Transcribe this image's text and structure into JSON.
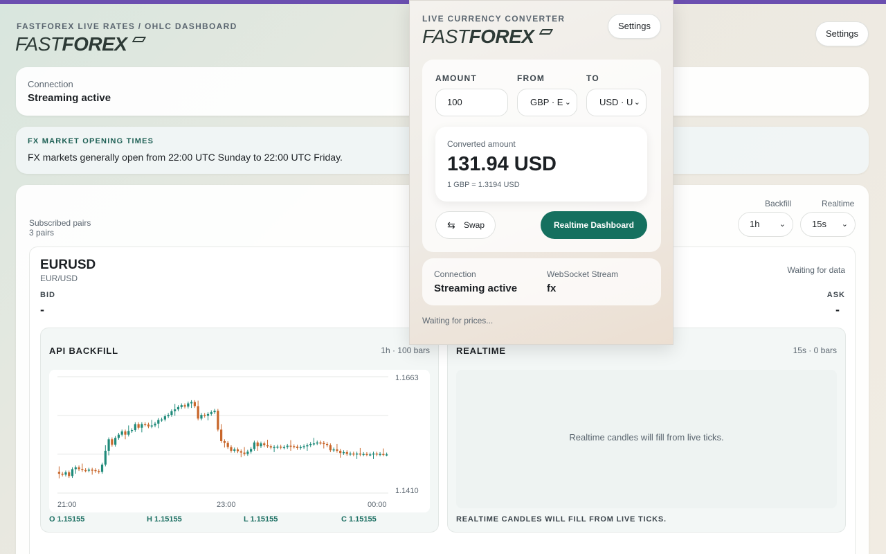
{
  "dashboard": {
    "subtitle": "FASTFOREX LIVE RATES / OHLC DASHBOARD",
    "logo_thin": "FAST",
    "logo_bold": "FOREX",
    "settings_label": "Settings",
    "connection": {
      "label": "Connection",
      "value": "Streaming active"
    },
    "market_info": {
      "title": "FX MARKET OPENING TIMES",
      "text": "FX markets generally open from 22:00 UTC Sunday to 22:00 UTC Friday."
    },
    "subscriptions": {
      "label": "Subscribed pairs",
      "count": "3 pairs"
    },
    "controls": {
      "backfill": {
        "label": "Backfill",
        "value": "1h"
      },
      "realtime": {
        "label": "Realtime",
        "value": "15s"
      }
    },
    "pair": {
      "symbol": "EURUSD",
      "name": "EUR/USD",
      "status": "Waiting for data",
      "bid_label": "BID",
      "bid_value": "-",
      "ask_label": "ASK",
      "ask_value": "-",
      "backfill_panel": {
        "title": "API BACKFILL",
        "meta": "1h · 100 bars",
        "ohlc": [
          "O 1.15155",
          "H 1.15155",
          "L 1.15155",
          "C 1.15155"
        ]
      },
      "realtime_panel": {
        "title": "REALTIME",
        "meta": "15s · 0 bars",
        "message": "Realtime candles will fill from live ticks.",
        "footer": "REALTIME CANDLES WILL FILL FROM LIVE TICKS."
      }
    }
  },
  "chart_data": {
    "type": "candlestick",
    "title": "",
    "x_tick_labels": [
      "21:00",
      "23:00",
      "00:00"
    ],
    "y_tick_labels": [
      "1.1663",
      "1.1410"
    ],
    "ylim": [
      1.141,
      1.1663
    ],
    "colors": {
      "up": "#1f8a7a",
      "down": "#c8662a"
    },
    "closes": [
      1.1452,
      1.145,
      1.1455,
      1.1447,
      1.1462,
      1.1466,
      1.1462,
      1.146,
      1.1459,
      1.1461,
      1.146,
      1.1458,
      1.1456,
      1.1472,
      1.1502,
      1.1527,
      1.1515,
      1.153,
      1.1537,
      1.1544,
      1.1537,
      1.1545,
      1.1547,
      1.156,
      1.1552,
      1.156,
      1.1559,
      1.1555,
      1.1557,
      1.1561,
      1.1569,
      1.157,
      1.1577,
      1.158,
      1.1588,
      1.1592,
      1.1597,
      1.1601,
      1.1598,
      1.1605,
      1.1608,
      1.1599,
      1.1572,
      1.158,
      1.1578,
      1.1582,
      1.1586,
      1.1589,
      1.1548,
      1.1523,
      1.1519,
      1.151,
      1.1502,
      1.1505,
      1.1501,
      1.1498,
      1.1495,
      1.15,
      1.1506,
      1.152,
      1.1512,
      1.1518,
      1.1514,
      1.1512,
      1.1509,
      1.151,
      1.1511,
      1.1509,
      1.151,
      1.1513,
      1.1512,
      1.1511,
      1.1508,
      1.151,
      1.1512,
      1.1514,
      1.1517,
      1.1518,
      1.152,
      1.1519,
      1.1517,
      1.1514,
      1.1503,
      1.1505,
      1.1502,
      1.1497,
      1.1499,
      1.1495,
      1.1496,
      1.1494,
      1.1496,
      1.1494,
      1.1495,
      1.1494,
      1.1494,
      1.1496,
      1.1494,
      1.1495,
      1.1494,
      1.1494
    ]
  },
  "converter": {
    "subtitle": "LIVE CURRENCY CONVERTER",
    "settings_label": "Settings",
    "amount_label": "AMOUNT",
    "from_label": "FROM",
    "to_label": "TO",
    "amount_value": "100",
    "from_value": "GBP · E",
    "to_value": "USD · U",
    "result_label": "Converted amount",
    "result_value": "131.94 USD",
    "rate_text": "1 GBP = 1.3194 USD",
    "swap_label": "Swap",
    "dashboard_button": "Realtime Dashboard",
    "connection": {
      "label": "Connection",
      "value": "Streaming active"
    },
    "stream": {
      "label": "WebSocket Stream",
      "value": "fx"
    },
    "status": "Waiting for prices..."
  }
}
